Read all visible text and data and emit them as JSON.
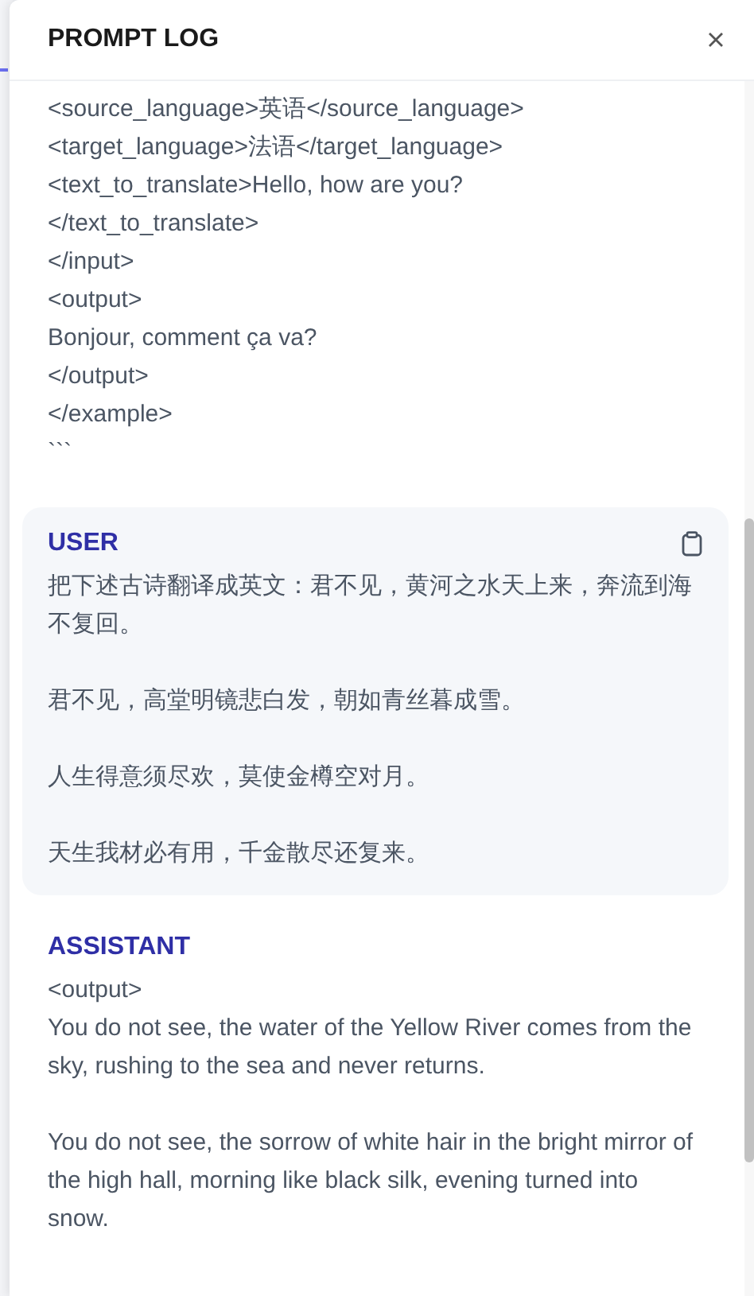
{
  "drawer": {
    "title": "PROMPT LOG"
  },
  "sections": [
    {
      "kind": "plain",
      "lines": [
        "<source_language>英语</source_language>",
        "<target_language>法语</target_language>",
        "<text_to_translate>Hello, how are you?",
        "</text_to_translate>",
        "</input>",
        "<output>",
        "Bonjour, comment ça va?",
        "</output>",
        "</example>",
        "```"
      ]
    },
    {
      "kind": "card",
      "role": "USER",
      "paragraphs": [
        "把下述古诗翻译成英文：君不见，黄河之水天上来，奔流到海不复回。",
        "君不见，高堂明镜悲白发，朝如青丝暮成雪。",
        "人生得意须尽欢，莫使金樽空对月。",
        "天生我材必有用，千金散尽还复来。"
      ]
    },
    {
      "kind": "plain",
      "role": "ASSISTANT",
      "lines": [
        "<output>"
      ],
      "paragraphs": [
        "You do not see, the water of the Yellow River comes from the sky, rushing to the sea and never returns.",
        "You do not see, the sorrow of white hair in the bright mirror of the high hall, morning like black silk, evening turned into snow."
      ]
    }
  ]
}
